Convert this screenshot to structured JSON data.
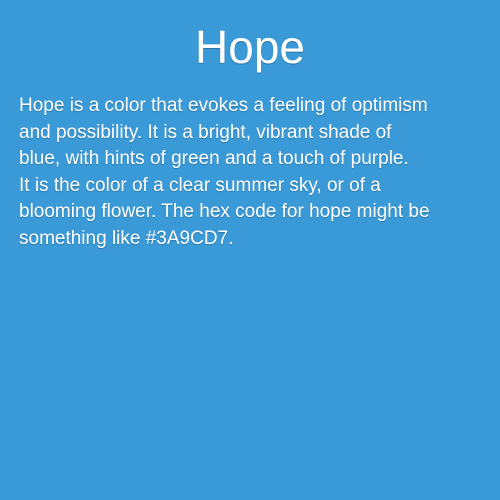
{
  "title": "Hope",
  "body_lines": [
    "Hope is a color that evokes a feeling of optimism",
    "and possibility. It is a bright, vibrant shade of",
    "blue, with hints of green and a touch of purple.",
    "It is the color of a clear summer sky, or of a",
    "blooming flower. The hex code for hope might be",
    "something like #3A9CD7."
  ],
  "colors": {
    "background": "#3A9AD7",
    "text": "#FFFFFF"
  }
}
